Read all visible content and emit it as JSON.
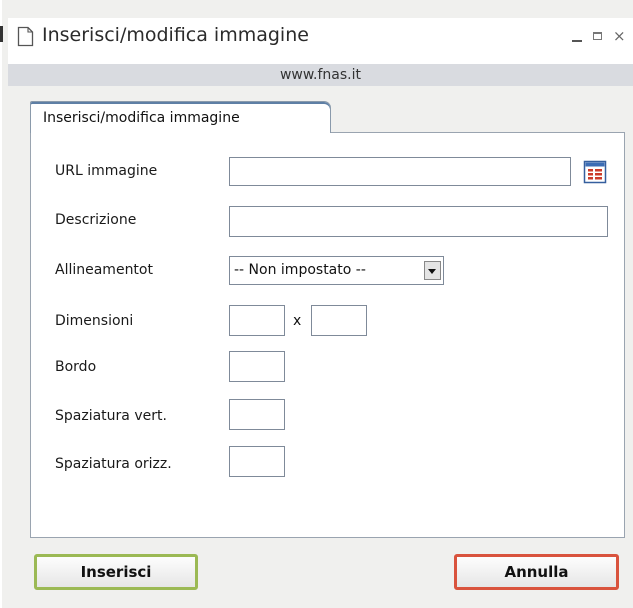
{
  "window": {
    "title": "Inserisci/modifica immagine",
    "minimize_glyph": "_",
    "close_glyph": "×",
    "url": "www.fnas.it"
  },
  "tab": {
    "label": "Inserisci/modifica immagine"
  },
  "form": {
    "url_label": "URL immagine",
    "url_value": "",
    "description_label": "Descrizione",
    "description_value": "",
    "alignment_label": "Allineamentot",
    "alignment_selected": "-- Non impostato --",
    "dimensions_label": "Dimensioni",
    "dimensions_separator": "x",
    "width_value": "",
    "height_value": "",
    "border_label": "Bordo",
    "border_value": "",
    "vspace_label": "Spaziatura vert.",
    "vspace_value": "",
    "hspace_label": "Spaziatura orizz.",
    "hspace_value": ""
  },
  "buttons": {
    "insert_label": "Inserisci",
    "cancel_label": "Annulla"
  },
  "colors": {
    "insert_border": "#9bb954",
    "cancel_border": "#d9533d",
    "tab_accent": "#5e7fa5"
  },
  "icons": {
    "window_icon": "document-icon",
    "browse_icon": "file-browser-icon",
    "dropdown_icon": "chevron-down-icon"
  }
}
